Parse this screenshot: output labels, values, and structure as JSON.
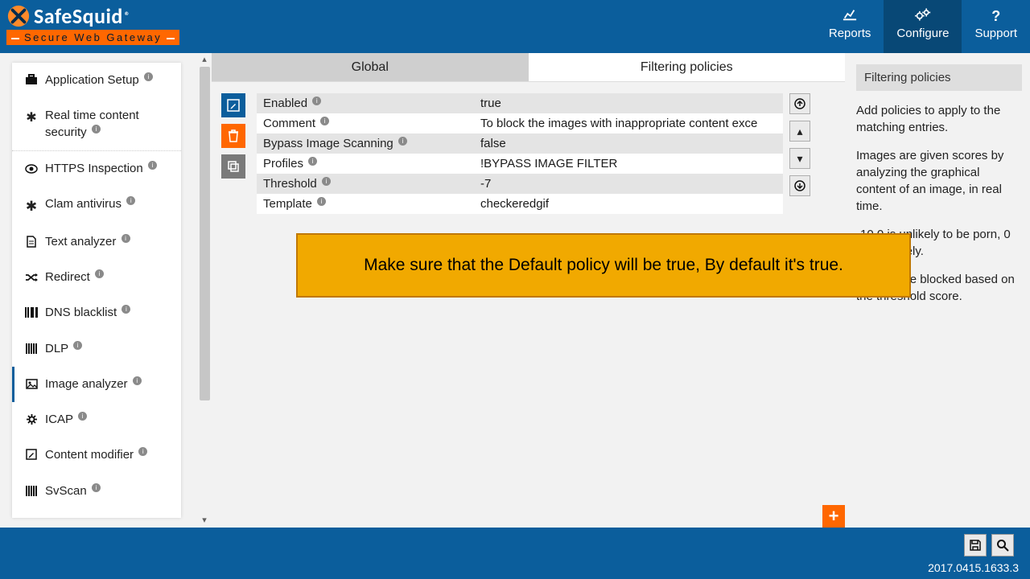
{
  "brand": {
    "name": "SafeSquid",
    "reg": "®",
    "tagline": "Secure Web Gateway"
  },
  "nav": {
    "reports": "Reports",
    "configure": "Configure",
    "support": "Support"
  },
  "sidebar": {
    "group1": [
      {
        "icon": "briefcase",
        "label": "Application Setup"
      },
      {
        "icon": "bug",
        "label": "Real time content security"
      }
    ],
    "group2": [
      {
        "icon": "eye",
        "label": "HTTPS Inspection"
      },
      {
        "icon": "star",
        "label": "Clam antivirus"
      },
      {
        "icon": "file",
        "label": "Text analyzer"
      },
      {
        "icon": "random",
        "label": "Redirect"
      },
      {
        "icon": "barcode",
        "label": "DNS blacklist"
      },
      {
        "icon": "bars",
        "label": "DLP"
      },
      {
        "icon": "image",
        "label": "Image analyzer"
      },
      {
        "icon": "gear",
        "label": "ICAP"
      },
      {
        "icon": "pencil",
        "label": "Content modifier"
      },
      {
        "icon": "bars",
        "label": "SvScan"
      }
    ],
    "selected_index": 6
  },
  "tabs": {
    "left": "Global",
    "right": "Filtering policies"
  },
  "props": [
    {
      "k": "Enabled",
      "v": "true"
    },
    {
      "k": "Comment",
      "v": "To block the images with inappropriate content exce"
    },
    {
      "k": "Bypass Image Scanning",
      "v": "false"
    },
    {
      "k": "Profiles",
      "v": "!BYPASS IMAGE FILTER"
    },
    {
      "k": "Threshold",
      "v": "-7"
    },
    {
      "k": "Template",
      "v": "checkeredgif"
    }
  ],
  "rightpanel": {
    "title": "Filtering policies",
    "p1": "Add policies to apply to the matching entries.",
    "p2": "Images are given scores by analyzing the graphical content of an image, in real time.",
    "p3": "-10.0 is unlikely to be porn, 0 is very likely.",
    "p4": "Images are blocked based on the threshold score."
  },
  "note": "Make sure that the Default policy will be true, By default it's true.",
  "footer": {
    "version": "2017.0415.1633.3"
  }
}
